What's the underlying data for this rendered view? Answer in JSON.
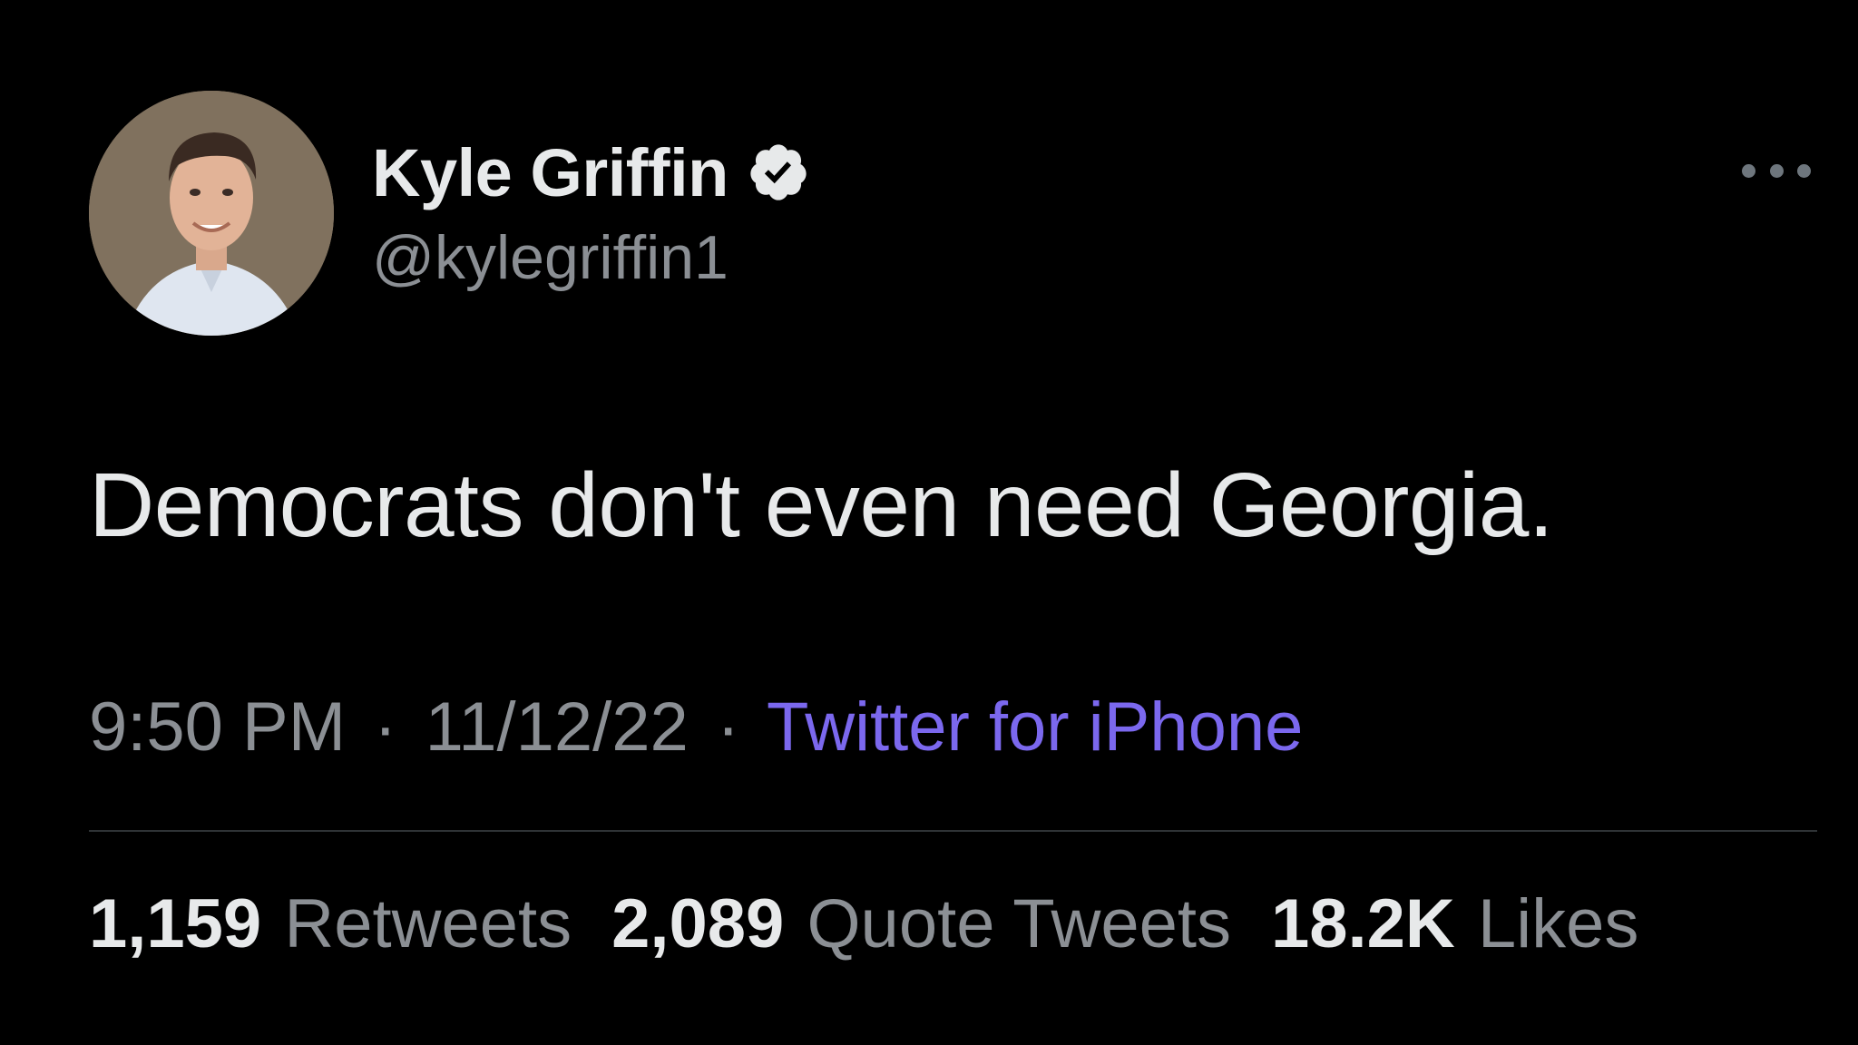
{
  "author": {
    "display_name": "Kyle Griffin",
    "handle": "@kylegriffin1",
    "verified_icon": "verified-badge-icon",
    "avatar_icon": "profile-photo"
  },
  "tweet": {
    "text": "Democrats don't even need Georgia."
  },
  "meta": {
    "time": "9:50 PM",
    "separator": "·",
    "date": "11/12/22",
    "source": "Twitter for iPhone"
  },
  "stats": {
    "retweets": {
      "count": "1,159",
      "label": "Retweets"
    },
    "quote_tweets": {
      "count": "2,089",
      "label": "Quote Tweets"
    },
    "likes": {
      "count": "18.2K",
      "label": "Likes"
    }
  },
  "icons": {
    "more": "more-options-icon"
  },
  "colors": {
    "background": "#000000",
    "primary_text": "#e7e9ea",
    "secondary_text": "#8b8f94",
    "source_link": "#7b68ee",
    "divider": "#2f3336"
  }
}
